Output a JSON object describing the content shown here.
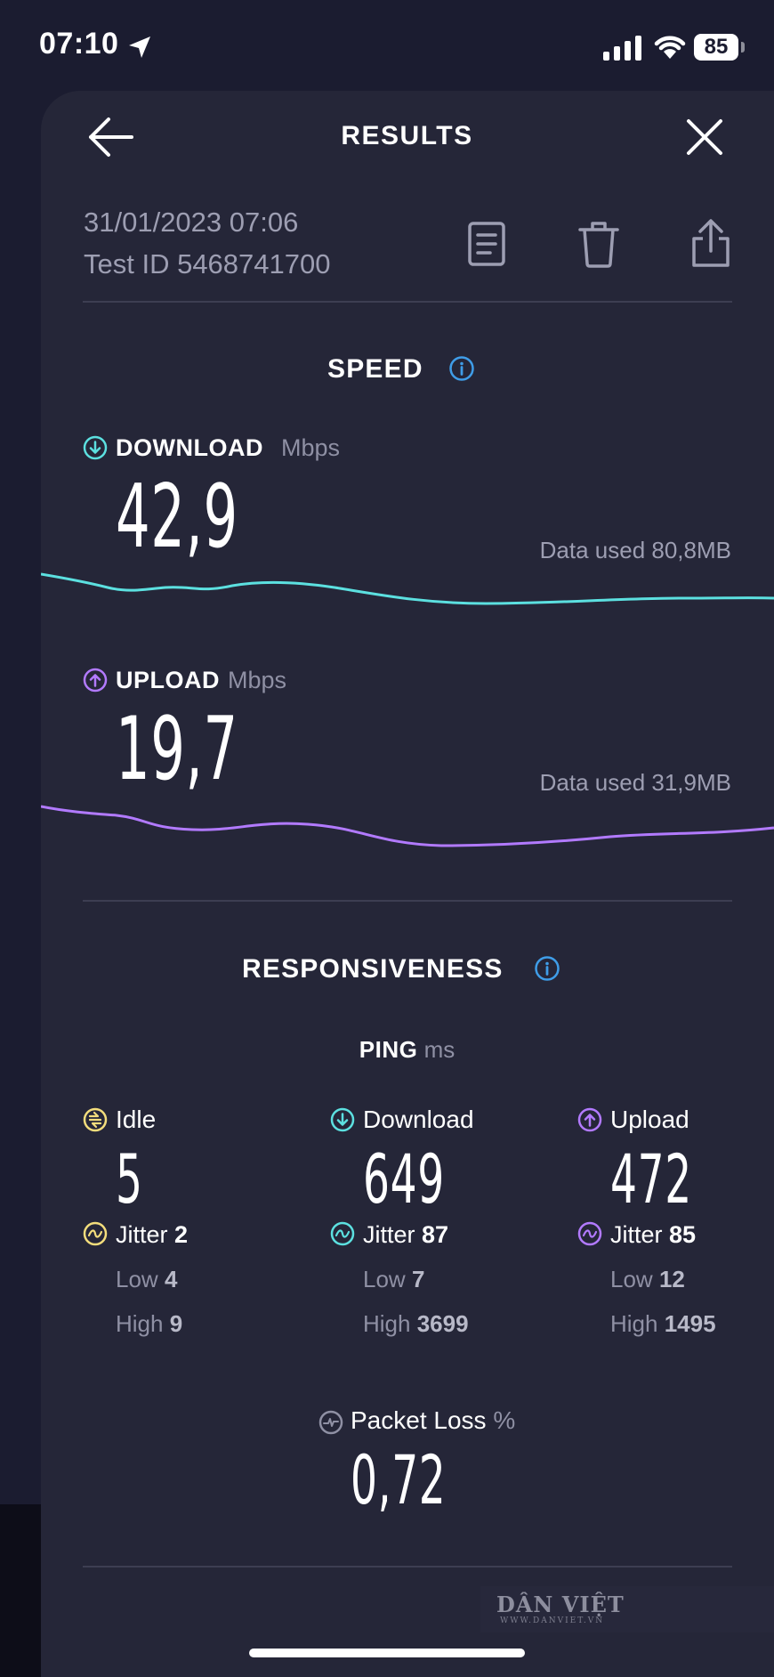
{
  "status_bar": {
    "time": "07:10",
    "battery": "85"
  },
  "header": {
    "title": "RESULTS"
  },
  "test": {
    "date": "31/01/2023 07:06",
    "test_id": "Test ID 5468741700"
  },
  "speed": {
    "title": "SPEED",
    "download": {
      "label": "DOWNLOAD",
      "unit": "Mbps",
      "value": "42,9",
      "data_used": "Data used 80,8MB"
    },
    "upload": {
      "label": "UPLOAD",
      "unit": "Mbps",
      "value": "19,7",
      "data_used": "Data used 31,9MB"
    }
  },
  "responsiveness": {
    "title": "RESPONSIVENESS",
    "ping_label": "PING",
    "ping_unit": "ms",
    "idle": {
      "label": "Idle",
      "value": "5",
      "jitter_label": "Jitter",
      "jitter": "2",
      "low_label": "Low",
      "low": "4",
      "high_label": "High",
      "high": "9"
    },
    "download": {
      "label": "Download",
      "value": "649",
      "jitter_label": "Jitter",
      "jitter": "87",
      "low_label": "Low",
      "low": "7",
      "high_label": "High",
      "high": "3699"
    },
    "upload": {
      "label": "Upload",
      "value": "472",
      "jitter_label": "Jitter",
      "jitter": "85",
      "low_label": "Low",
      "low": "12",
      "high_label": "High",
      "high": "1495"
    }
  },
  "packet_loss": {
    "label": "Packet Loss",
    "unit": "%",
    "value": "0,72"
  },
  "watermark": {
    "brand": "DÂN VIỆT",
    "site": "WWW.DANVIET.VN"
  },
  "colors": {
    "download": "#5ce0e0",
    "upload": "#b27aff",
    "idle": "#f3dd7c",
    "info": "#3f9de8"
  }
}
